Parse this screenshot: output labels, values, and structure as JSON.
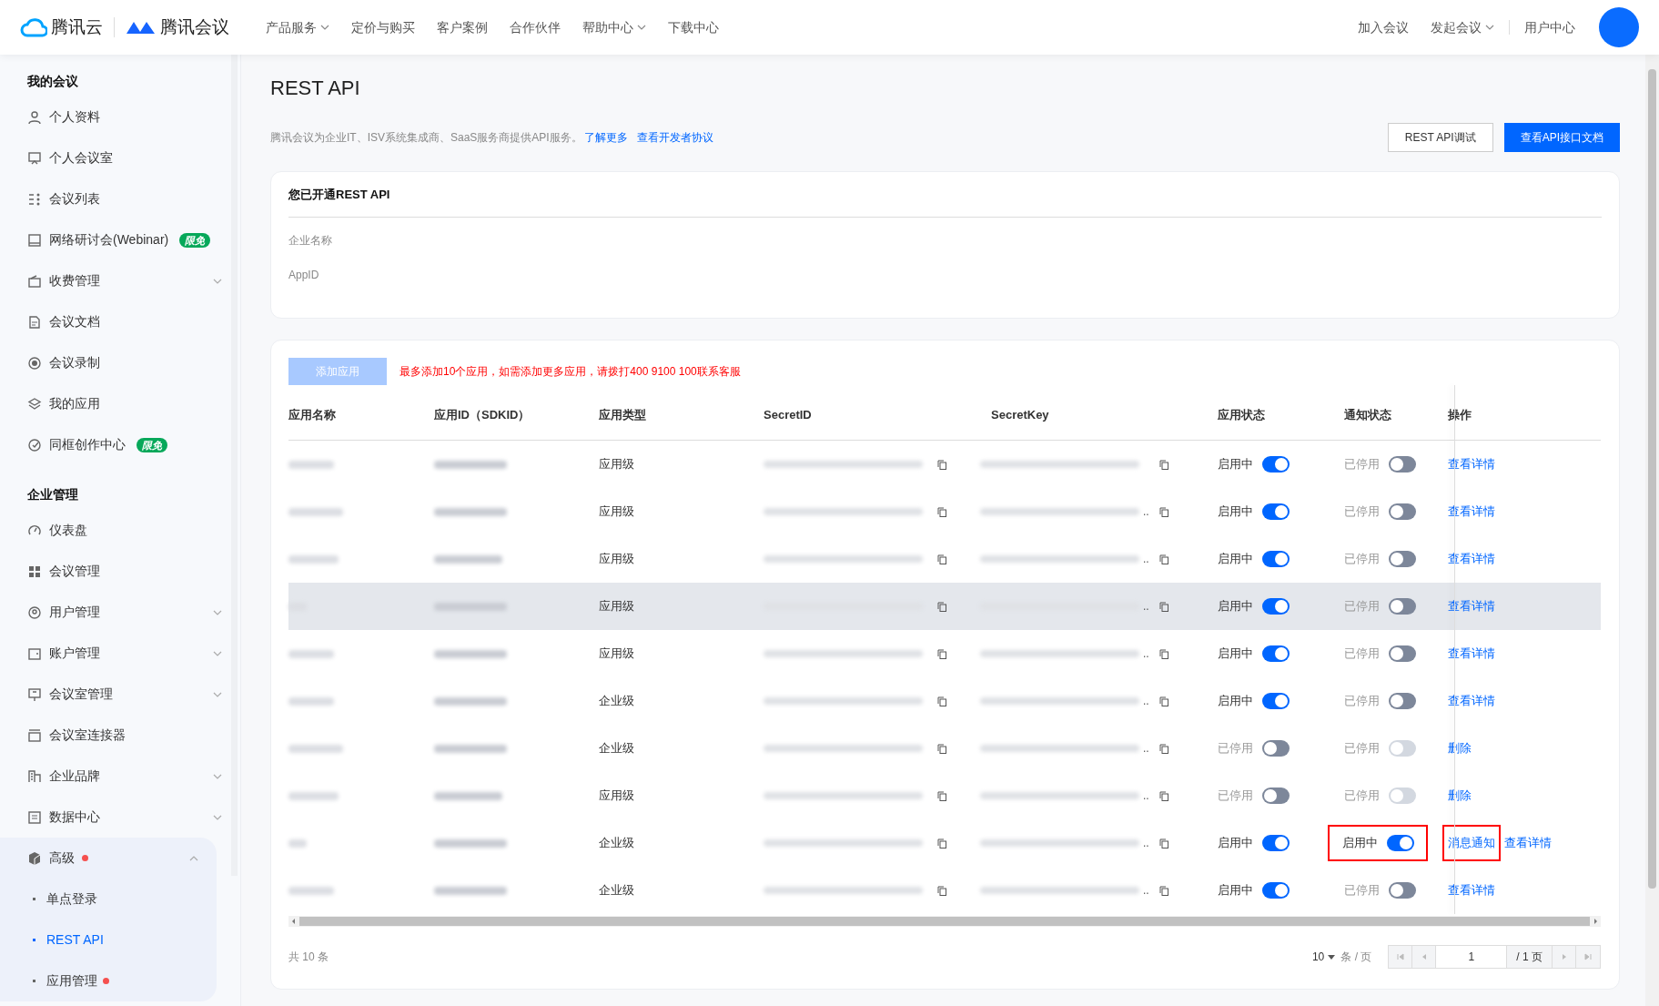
{
  "top_nav": {
    "brand_cloud": "腾讯云",
    "brand_meeting": "腾讯会议",
    "menu": [
      {
        "label": "产品服务",
        "dropdown": true
      },
      {
        "label": "定价与购买",
        "dropdown": false
      },
      {
        "label": "客户案例",
        "dropdown": false
      },
      {
        "label": "合作伙伴",
        "dropdown": false
      },
      {
        "label": "帮助中心",
        "dropdown": true
      },
      {
        "label": "下载中心",
        "dropdown": false
      }
    ],
    "actions": [
      {
        "label": "加入会议",
        "dropdown": false
      },
      {
        "label": "发起会议",
        "dropdown": true
      }
    ],
    "user_center": "用户中心"
  },
  "sidebar": {
    "sections": [
      {
        "title": "我的会议",
        "items": [
          {
            "kind": "link",
            "label": "个人资料",
            "selected": false
          },
          {
            "kind": "link",
            "label": "个人会议室",
            "selected": false
          },
          {
            "kind": "link",
            "label": "会议列表",
            "selected": false
          },
          {
            "kind": "link",
            "label": "网络研讨会(Webinar)",
            "badge": "限免",
            "selected": false
          },
          {
            "kind": "group",
            "label": "收费管理",
            "expanded": false,
            "selected": false
          },
          {
            "kind": "link",
            "label": "会议文档",
            "selected": false
          },
          {
            "kind": "link",
            "label": "会议录制",
            "selected": false
          },
          {
            "kind": "link",
            "label": "我的应用",
            "selected": false
          },
          {
            "kind": "link",
            "label": "同框创作中心",
            "badge": "限免",
            "selected": false
          }
        ]
      },
      {
        "title": "企业管理",
        "items": [
          {
            "kind": "link",
            "label": "仪表盘",
            "selected": false
          },
          {
            "kind": "link",
            "label": "会议管理",
            "selected": false
          },
          {
            "kind": "group",
            "label": "用户管理",
            "expanded": false,
            "selected": false
          },
          {
            "kind": "group",
            "label": "账户管理",
            "expanded": false,
            "selected": false
          },
          {
            "kind": "group",
            "label": "会议室管理",
            "expanded": false,
            "selected": false
          },
          {
            "kind": "link",
            "label": "会议室连接器",
            "selected": false
          },
          {
            "kind": "group",
            "label": "企业品牌",
            "expanded": false,
            "selected": false
          },
          {
            "kind": "group",
            "label": "数据中心",
            "expanded": false,
            "selected": false
          },
          {
            "kind": "group",
            "label": "高级",
            "dot": true,
            "expanded": true,
            "selected": false,
            "children": [
              {
                "label": "单点登录",
                "selected": false,
                "dot": false
              },
              {
                "label": "REST API",
                "selected": true,
                "dot": false
              },
              {
                "label": "应用管理",
                "selected": false,
                "dot": true
              }
            ]
          }
        ]
      }
    ]
  },
  "page": {
    "title": "REST API",
    "description": "腾讯会议为企业IT、ISV系统集成商、SaaS服务商提供API服务。",
    "links": [
      "了解更多",
      "查看开发者协议"
    ],
    "buttons": [
      {
        "label": "REST API调试",
        "kind": "secondary"
      },
      {
        "label": "查看API接口文档",
        "kind": "primary"
      }
    ]
  },
  "status_card": {
    "title": "您已开通REST API",
    "fields": [
      {
        "label": "企业名称"
      },
      {
        "label": "AppID"
      }
    ]
  },
  "apps": {
    "add_button": {
      "label": "添加应用",
      "disabled": true
    },
    "limit_notice": "最多添加10个应用，如需添加更多应用，请拨打400 9100 100联系客服",
    "columns": [
      "应用名称",
      "应用ID（SDKID）",
      "应用类型",
      "SecretID",
      "SecretKey",
      "应用状态",
      "通知状态",
      "操作"
    ],
    "rows": [
      {
        "type": "应用级",
        "hovered": false,
        "app_status": {
          "label": "启用中",
          "on": true
        },
        "notify_status": {
          "label": "已停用",
          "on": false,
          "disabled": false,
          "highlighted": false
        },
        "actions": [
          {
            "label": "查看详情",
            "highlighted": false
          }
        ]
      },
      {
        "type": "应用级",
        "key_overflow": "..",
        "hovered": false,
        "app_status": {
          "label": "启用中",
          "on": true
        },
        "notify_status": {
          "label": "已停用",
          "on": false,
          "disabled": false,
          "highlighted": false
        },
        "actions": [
          {
            "label": "查看详情",
            "highlighted": false
          }
        ]
      },
      {
        "type": "应用级",
        "key_overflow": "..",
        "hovered": false,
        "app_status": {
          "label": "启用中",
          "on": true
        },
        "notify_status": {
          "label": "已停用",
          "on": false,
          "disabled": false,
          "highlighted": false
        },
        "actions": [
          {
            "label": "查看详情",
            "highlighted": false
          }
        ]
      },
      {
        "type": "应用级",
        "key_overflow": "..",
        "hovered": true,
        "app_status": {
          "label": "启用中",
          "on": true
        },
        "notify_status": {
          "label": "已停用",
          "on": false,
          "disabled": false,
          "highlighted": false
        },
        "actions": [
          {
            "label": "查看详情",
            "highlighted": false
          }
        ]
      },
      {
        "type": "应用级",
        "key_overflow": "..",
        "hovered": false,
        "app_status": {
          "label": "启用中",
          "on": true
        },
        "notify_status": {
          "label": "已停用",
          "on": false,
          "disabled": false,
          "highlighted": false
        },
        "actions": [
          {
            "label": "查看详情",
            "highlighted": false
          }
        ]
      },
      {
        "type": "企业级",
        "key_overflow": "..",
        "hovered": false,
        "app_status": {
          "label": "启用中",
          "on": true
        },
        "notify_status": {
          "label": "已停用",
          "on": false,
          "disabled": false,
          "highlighted": false
        },
        "actions": [
          {
            "label": "查看详情",
            "highlighted": false
          }
        ]
      },
      {
        "type": "企业级",
        "key_overflow": "..",
        "hovered": false,
        "app_status": {
          "label": "已停用",
          "on": false
        },
        "notify_status": {
          "label": "已停用",
          "on": false,
          "disabled": true,
          "highlighted": false
        },
        "actions": [
          {
            "label": "删除",
            "highlighted": false
          }
        ]
      },
      {
        "type": "应用级",
        "key_overflow": "..",
        "hovered": false,
        "app_status": {
          "label": "已停用",
          "on": false
        },
        "notify_status": {
          "label": "已停用",
          "on": false,
          "disabled": true,
          "highlighted": false
        },
        "actions": [
          {
            "label": "删除",
            "highlighted": false
          }
        ]
      },
      {
        "type": "企业级",
        "key_overflow": "..",
        "hovered": false,
        "app_status": {
          "label": "启用中",
          "on": true
        },
        "notify_status": {
          "label": "启用中",
          "on": true,
          "disabled": false,
          "highlighted": true
        },
        "actions": [
          {
            "label": "消息通知",
            "highlighted": true
          },
          {
            "label": "查看详情",
            "highlighted": false
          }
        ]
      },
      {
        "type": "企业级",
        "key_overflow": "..",
        "hovered": false,
        "app_status": {
          "label": "启用中",
          "on": true
        },
        "notify_status": {
          "label": "已停用",
          "on": false,
          "disabled": false,
          "highlighted": false
        },
        "actions": [
          {
            "label": "查看详情",
            "highlighted": false
          }
        ]
      }
    ],
    "pagination": {
      "total": "共 10 条",
      "page_size": "10",
      "page_size_unit": "条 / 页",
      "page": "1",
      "page_count": "/ 1 页"
    }
  }
}
